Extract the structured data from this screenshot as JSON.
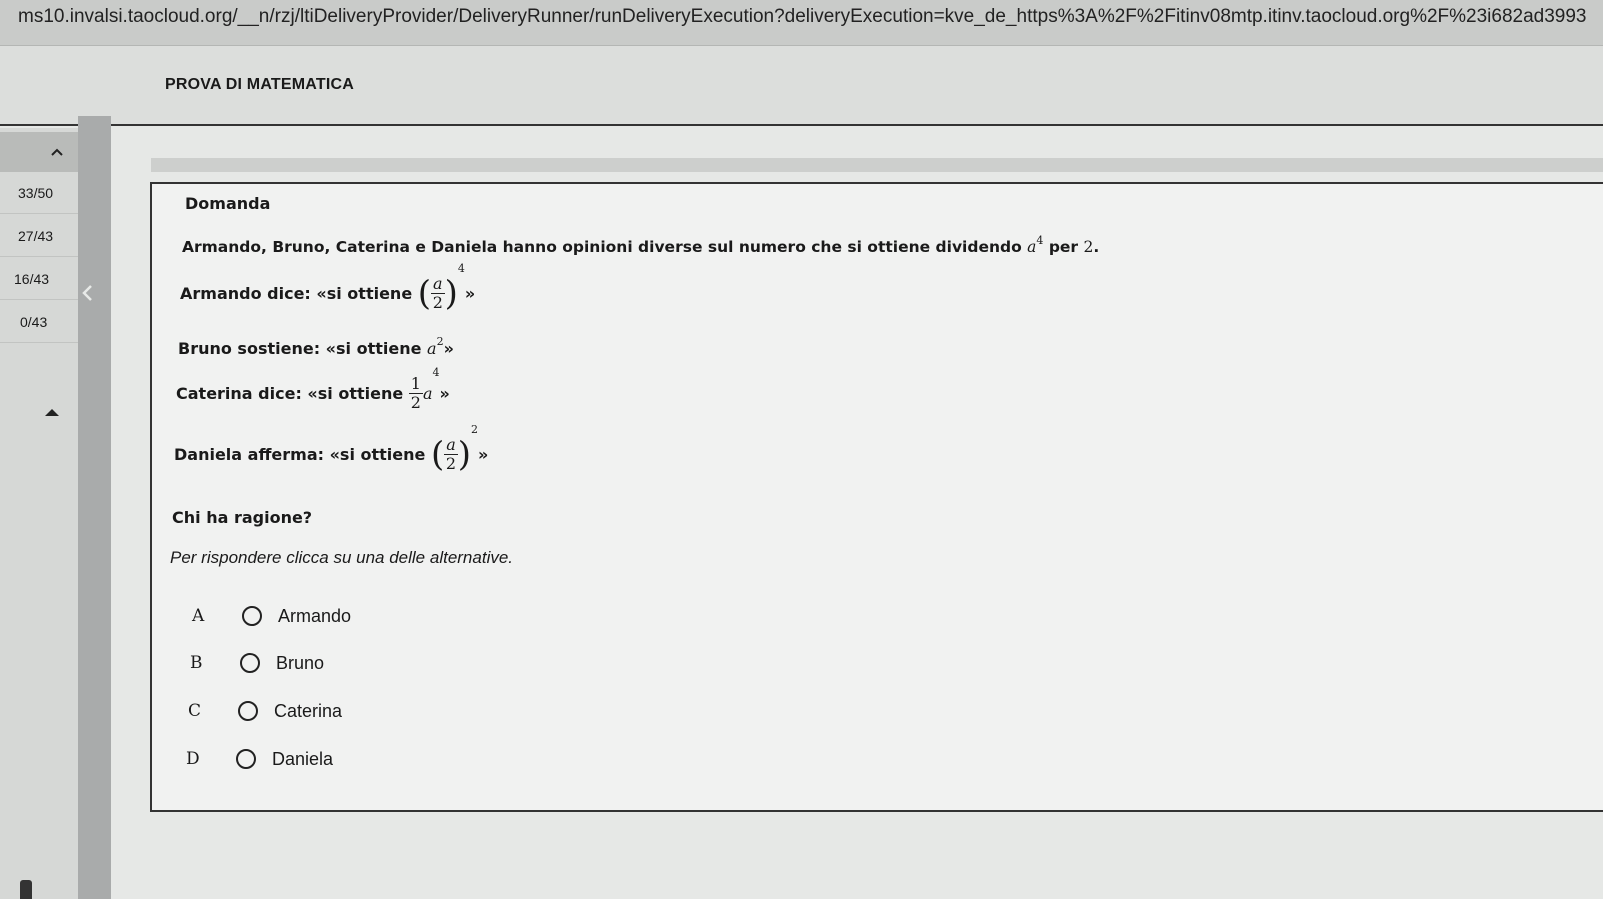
{
  "browser": {
    "url": "ms10.invalsi.taocloud.org/__n/rzj/ltiDeliveryProvider/DeliveryRunner/runDeliveryExecution?deliveryExecution=kve_de_https%3A%2F%2Fitinv08mtp.itinv.taocloud.org%2F%23i682ad3993"
  },
  "header": {
    "title": "PROVA DI MATEMATICA"
  },
  "sidebar": {
    "collapse_icon": "chevron-up-icon",
    "items": [
      {
        "label": "33/50"
      },
      {
        "label": "27/43"
      },
      {
        "label": "16/43"
      },
      {
        "label": "0/43"
      }
    ],
    "collapse_arrow_icon": "triangle-up-icon",
    "scroll_icon": "chevron-left-icon"
  },
  "question": {
    "heading": "Domanda",
    "intro": "Armando, Bruno, Caterina e Daniela hanno opinioni diverse sul numero che si ottiene dividendo",
    "intro_var": "a",
    "intro_exp": "4",
    "intro_per": "per",
    "intro_num": "2",
    "intro_end": ".",
    "statements": {
      "armando": {
        "text": "Armando dice: «si ottiene",
        "num": "a",
        "den": "2",
        "exp": "4",
        "close": "»"
      },
      "bruno": {
        "text": "Bruno sostiene: «si ottiene",
        "var": "a",
        "exp": "2",
        "close": "»"
      },
      "caterina": {
        "text": "Caterina dice: «si ottiene",
        "num": "1",
        "den": "2",
        "var": "a",
        "exp": "4",
        "close": "»"
      },
      "daniela": {
        "text": "Daniela afferma: «si ottiene",
        "num": "a",
        "den": "2",
        "exp": "2",
        "close": "»"
      }
    },
    "prompt": "Chi ha ragione?",
    "instruction": "Per rispondere clicca su una delle alternative.",
    "options": [
      {
        "letter": "A",
        "label": "Armando"
      },
      {
        "letter": "B",
        "label": "Bruno"
      },
      {
        "letter": "C",
        "label": "Caterina"
      },
      {
        "letter": "D",
        "label": "Daniela"
      }
    ]
  }
}
